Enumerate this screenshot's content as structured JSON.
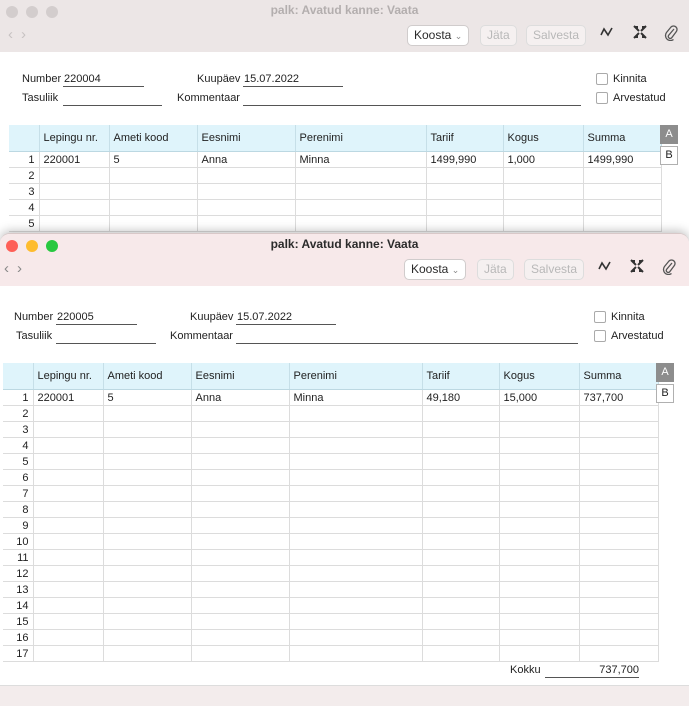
{
  "back_window": {
    "title": "palk: Avatud kanne: Vaata",
    "toolbar": {
      "koosta": "Koosta",
      "jata": "Jäta",
      "salvesta": "Salvesta"
    },
    "form": {
      "number_label": "Number",
      "number_value": "220004",
      "kuupaev_label": "Kuupäev",
      "kuupaev_value": "15.07.2022",
      "tasuliik_label": "Tasuliik",
      "tasuliik_value": "",
      "kommentaar_label": "Kommentaar",
      "kommentaar_value": "",
      "kinnita_label": "Kinnita",
      "arvestatud_label": "Arvestatud"
    },
    "columns": [
      "Lepingu nr.",
      "Ameti kood",
      "Eesnimi",
      "Perenimi",
      "Tariif",
      "Kogus",
      "Summa"
    ],
    "rows": [
      {
        "n": "1",
        "cells": [
          "220001",
          "5",
          "Anna",
          "Minna",
          "1499,990",
          "1,000",
          "1499,990"
        ]
      },
      {
        "n": "2",
        "cells": [
          "",
          "",
          "",
          "",
          "",
          "",
          ""
        ]
      },
      {
        "n": "3",
        "cells": [
          "",
          "",
          "",
          "",
          "",
          "",
          ""
        ]
      },
      {
        "n": "4",
        "cells": [
          "",
          "",
          "",
          "",
          "",
          "",
          ""
        ]
      },
      {
        "n": "5",
        "cells": [
          "",
          "",
          "",
          "",
          "",
          "",
          ""
        ]
      }
    ],
    "tabs": [
      "A",
      "B"
    ]
  },
  "front_window": {
    "title": "palk: Avatud kanne: Vaata",
    "toolbar": {
      "koosta": "Koosta",
      "jata": "Jäta",
      "salvesta": "Salvesta"
    },
    "form": {
      "number_label": "Number",
      "number_value": "220005",
      "kuupaev_label": "Kuupäev",
      "kuupaev_value": "15.07.2022",
      "tasuliik_label": "Tasuliik",
      "tasuliik_value": "",
      "kommentaar_label": "Kommentaar",
      "kommentaar_value": "",
      "kinnita_label": "Kinnita",
      "arvestatud_label": "Arvestatud"
    },
    "columns": [
      "Lepingu nr.",
      "Ameti kood",
      "Eesnimi",
      "Perenimi",
      "Tariif",
      "Kogus",
      "Summa"
    ],
    "rows": [
      {
        "n": "1",
        "cells": [
          "220001",
          "5",
          "Anna",
          "Minna",
          "49,180",
          "15,000",
          "737,700"
        ]
      },
      {
        "n": "2",
        "cells": [
          "",
          "",
          "",
          "",
          "",
          "",
          ""
        ]
      },
      {
        "n": "3",
        "cells": [
          "",
          "",
          "",
          "",
          "",
          "",
          ""
        ]
      },
      {
        "n": "4",
        "cells": [
          "",
          "",
          "",
          "",
          "",
          "",
          ""
        ]
      },
      {
        "n": "5",
        "cells": [
          "",
          "",
          "",
          "",
          "",
          "",
          ""
        ]
      },
      {
        "n": "6",
        "cells": [
          "",
          "",
          "",
          "",
          "",
          "",
          ""
        ]
      },
      {
        "n": "7",
        "cells": [
          "",
          "",
          "",
          "",
          "",
          "",
          ""
        ]
      },
      {
        "n": "8",
        "cells": [
          "",
          "",
          "",
          "",
          "",
          "",
          ""
        ]
      },
      {
        "n": "9",
        "cells": [
          "",
          "",
          "",
          "",
          "",
          "",
          ""
        ]
      },
      {
        "n": "10",
        "cells": [
          "",
          "",
          "",
          "",
          "",
          "",
          ""
        ]
      },
      {
        "n": "11",
        "cells": [
          "",
          "",
          "",
          "",
          "",
          "",
          ""
        ]
      },
      {
        "n": "12",
        "cells": [
          "",
          "",
          "",
          "",
          "",
          "",
          ""
        ]
      },
      {
        "n": "13",
        "cells": [
          "",
          "",
          "",
          "",
          "",
          "",
          ""
        ]
      },
      {
        "n": "14",
        "cells": [
          "",
          "",
          "",
          "",
          "",
          "",
          ""
        ]
      },
      {
        "n": "15",
        "cells": [
          "",
          "",
          "",
          "",
          "",
          "",
          ""
        ]
      },
      {
        "n": "16",
        "cells": [
          "",
          "",
          "",
          "",
          "",
          "",
          ""
        ]
      },
      {
        "n": "17",
        "cells": [
          "",
          "",
          "",
          "",
          "",
          "",
          ""
        ]
      }
    ],
    "tabs": [
      "A",
      "B"
    ],
    "total_label": "Kokku",
    "total_value": "737,700"
  },
  "icons": {
    "back": "‹",
    "forward": "›",
    "chevron": "⌄",
    "chart": "∿",
    "expand": "⤧",
    "attach": "📎"
  }
}
